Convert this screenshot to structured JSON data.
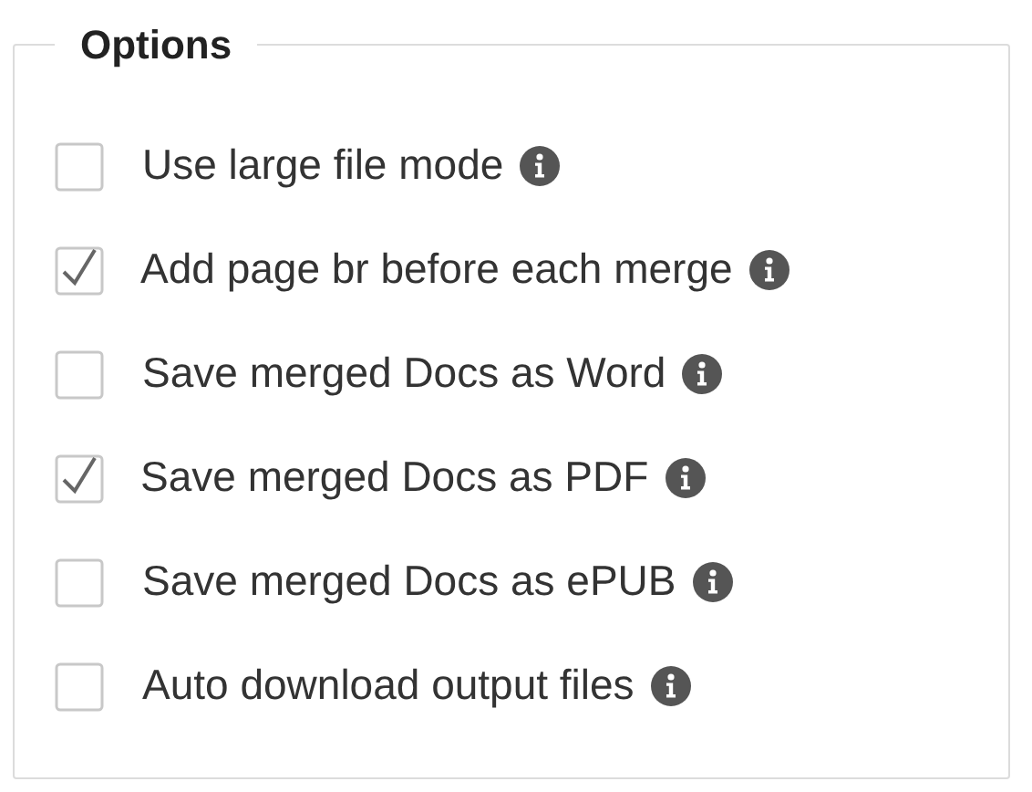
{
  "title": "Options",
  "options": [
    {
      "label": "Use large file mode",
      "checked": false
    },
    {
      "label": "Add page br before each merge",
      "checked": true
    },
    {
      "label": "Save merged Docs as Word",
      "checked": false
    },
    {
      "label": "Save merged Docs as PDF",
      "checked": true
    },
    {
      "label": "Save merged Docs as ePUB",
      "checked": false
    },
    {
      "label": "Auto download output files",
      "checked": false
    }
  ]
}
